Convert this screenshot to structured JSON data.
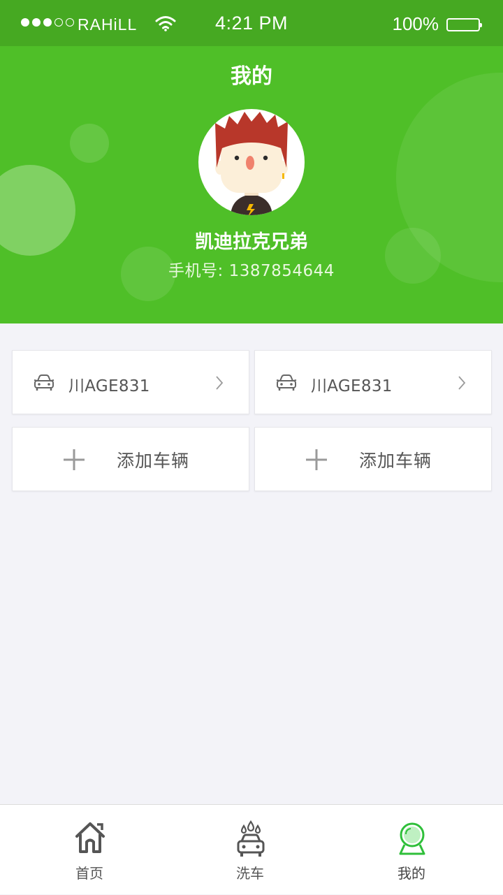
{
  "status_bar": {
    "carrier": "RAHiLL",
    "time": "4:21 PM",
    "battery": "100%",
    "signal_bars_filled": 3,
    "signal_bars_total": 5
  },
  "header": {
    "title": "我的",
    "user_name": "凯迪拉克兄弟",
    "phone_label": "手机号:",
    "phone_number": "1387854644"
  },
  "vehicles": [
    {
      "plate": "川AGE831",
      "icon": "car-icon"
    },
    {
      "plate": "川AGE831",
      "icon": "car-icon"
    }
  ],
  "add_buttons": [
    {
      "label": "添加车辆",
      "icon": "plus-icon"
    },
    {
      "label": "添加车辆",
      "icon": "plus-icon"
    }
  ],
  "tabbar": {
    "items": [
      {
        "label": "首页",
        "icon": "home-icon",
        "active": false
      },
      {
        "label": "洗车",
        "icon": "car-wash-icon",
        "active": false
      },
      {
        "label": "我的",
        "icon": "profile-icon",
        "active": true
      }
    ]
  },
  "colors": {
    "brand_green": "#4fbf28",
    "status_bar_green": "#46a922",
    "active_tab_green": "#2fbf3a",
    "background": "#f3f3f8"
  }
}
